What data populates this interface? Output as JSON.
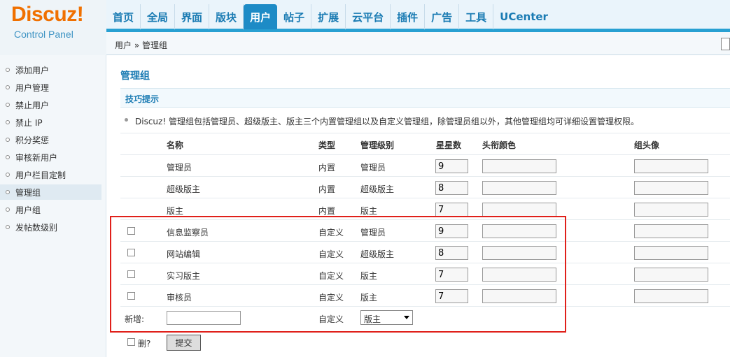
{
  "logo": {
    "brand": "Discuz!",
    "subtitle": "Control Panel"
  },
  "topnav": [
    "首页",
    "全局",
    "界面",
    "版块",
    "用户",
    "帖子",
    "扩展",
    "云平台",
    "插件",
    "广告",
    "工具",
    "UCenter"
  ],
  "topnav_active": "用户",
  "breadcrumb": "用户 » 管理组",
  "sidebar": [
    {
      "label": "添加用户",
      "active": false
    },
    {
      "label": "用户管理",
      "active": false
    },
    {
      "label": "禁止用户",
      "active": false
    },
    {
      "label": "禁止 IP",
      "active": false
    },
    {
      "label": "积分奖惩",
      "active": false
    },
    {
      "label": "审核新用户",
      "active": false
    },
    {
      "label": "用户栏目定制",
      "active": false
    },
    {
      "label": "管理组",
      "active": true
    },
    {
      "label": "用户组",
      "active": false
    },
    {
      "label": "发帖数级别",
      "active": false
    }
  ],
  "page_title": "管理组",
  "tips": {
    "title": "技巧提示",
    "text": "Discuz! 管理组包括管理员、超级版主、版主三个内置管理组以及自定义管理组，除管理员组以外，其他管理组均可详细设置管理权限。"
  },
  "table": {
    "headers": {
      "name": "名称",
      "type": "类型",
      "level": "管理级别",
      "stars": "星星数",
      "color": "头衔颜色",
      "avatar": "组头像"
    },
    "rows": [
      {
        "name": "管理员",
        "type": "内置",
        "level": "管理员",
        "stars": "9",
        "checkbox": false
      },
      {
        "name": "超级版主",
        "type": "内置",
        "level": "超级版主",
        "stars": "8",
        "checkbox": false
      },
      {
        "name": "版主",
        "type": "内置",
        "level": "版主",
        "stars": "7",
        "checkbox": false
      },
      {
        "name": "信息监察员",
        "type": "自定义",
        "level": "管理员",
        "stars": "9",
        "checkbox": true
      },
      {
        "name": "网站编辑",
        "type": "自定义",
        "level": "超级版主",
        "stars": "8",
        "checkbox": true
      },
      {
        "name": "实习版主",
        "type": "自定义",
        "level": "版主",
        "stars": "7",
        "checkbox": true
      },
      {
        "name": "审核员",
        "type": "自定义",
        "level": "版主",
        "stars": "7",
        "checkbox": true
      }
    ],
    "new_row": {
      "label": "新增:",
      "type": "自定义",
      "level_selected": "版主"
    }
  },
  "delete_label": "删?",
  "submit_label": "提交",
  "colors": {
    "accent": "#1d8bc6",
    "logo": "#f07000",
    "highlight_box": "#e0201a"
  }
}
